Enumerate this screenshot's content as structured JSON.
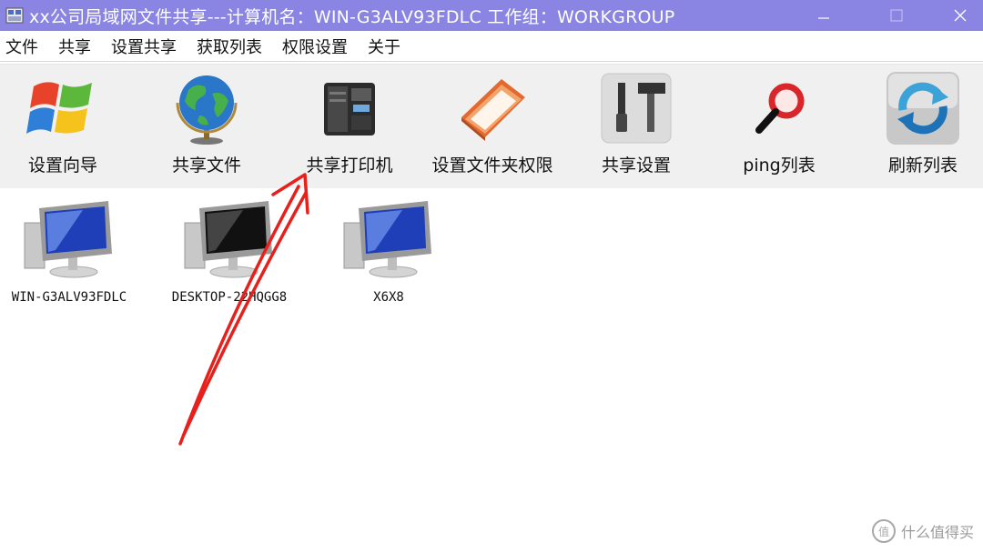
{
  "window": {
    "title": "xx公司局域网文件共享---计算机名：WIN-G3ALV93FDLC  工作组：WORKGROUP",
    "titlebar_color": "#8a84e2"
  },
  "menu": {
    "items": [
      "文件",
      "共享",
      "设置共享",
      "获取列表",
      "权限设置",
      "关于"
    ]
  },
  "toolbar": {
    "buttons": [
      {
        "label": "设置向导",
        "icon": "windows-logo-icon"
      },
      {
        "label": "共享文件",
        "icon": "globe-icon"
      },
      {
        "label": "共享打印机",
        "icon": "printer-icon"
      },
      {
        "label": "设置文件夹权限",
        "icon": "folder-book-icon"
      },
      {
        "label": "共享设置",
        "icon": "tools-icon"
      },
      {
        "label": "ping列表",
        "icon": "magnifier-icon"
      },
      {
        "label": "刷新列表",
        "icon": "refresh-icon"
      }
    ]
  },
  "computers": [
    {
      "name": "WIN-G3ALV93FDLC",
      "screen": "blue"
    },
    {
      "name": "DESKTOP-22HQGG8",
      "screen": "black"
    },
    {
      "name": "X6X8",
      "screen": "blue"
    }
  ],
  "annotation": {
    "color": "#e8201c"
  },
  "watermark": {
    "badge": "值",
    "text": "什么值得买"
  }
}
